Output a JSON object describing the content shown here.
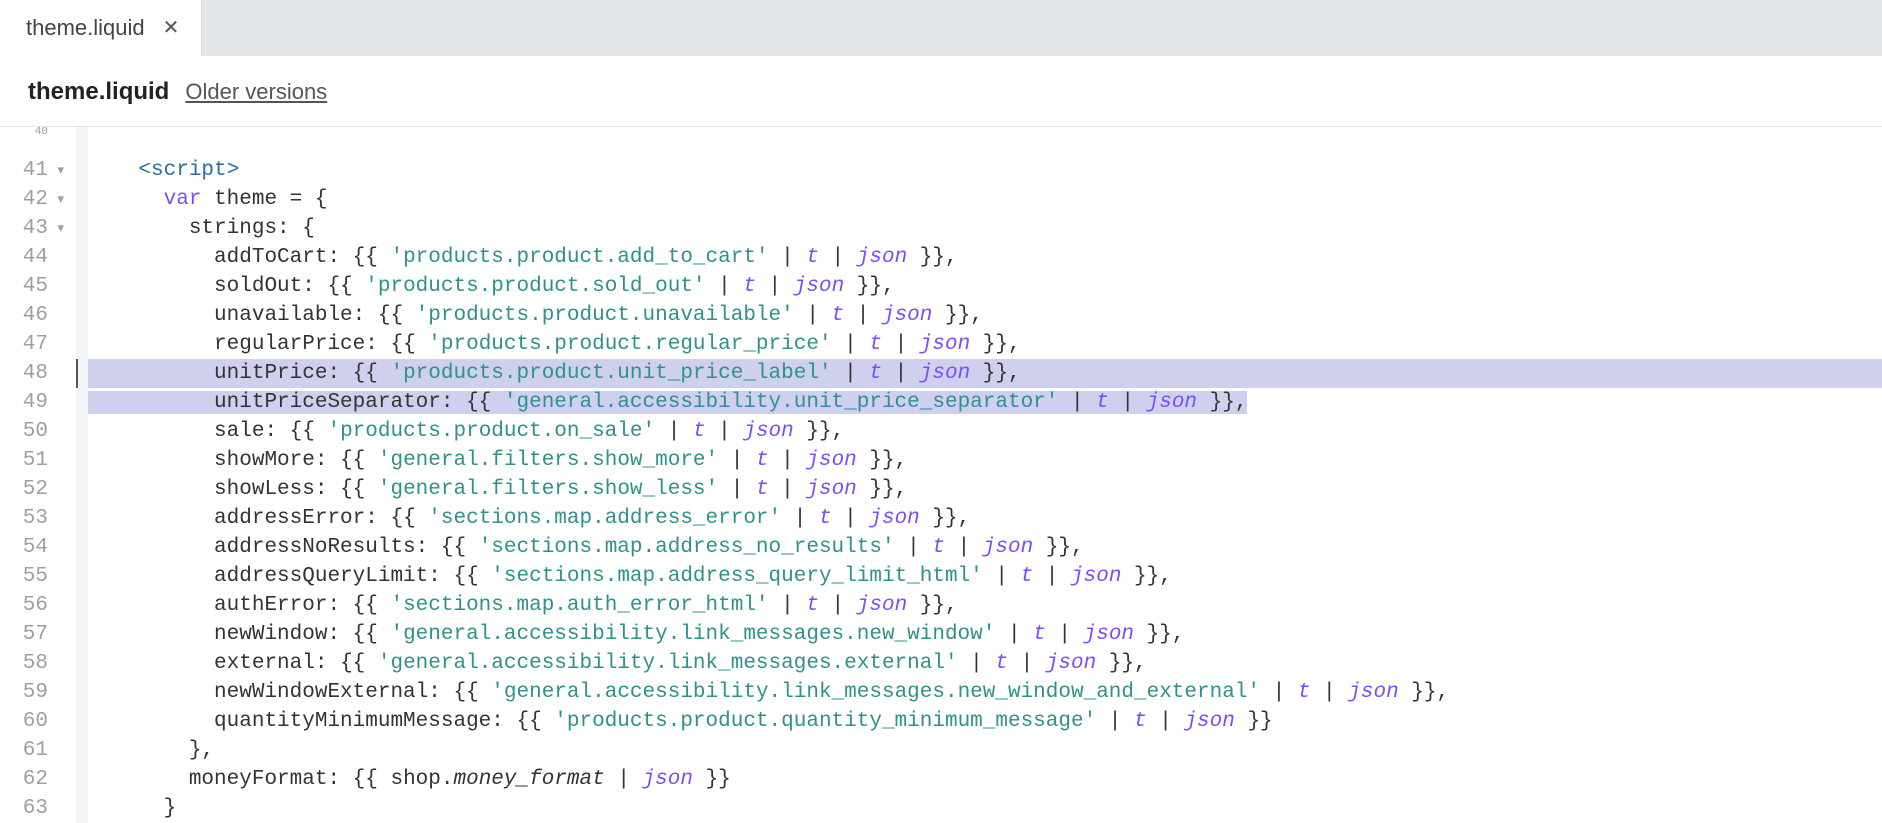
{
  "tab": {
    "label": "theme.liquid"
  },
  "subheader": {
    "title": "theme.liquid",
    "older": "Older versions"
  },
  "lines": [
    {
      "n": 40,
      "kind": "tiny",
      "html": ""
    },
    {
      "n": 41,
      "kind": "fold",
      "html": "    <span class='tok-tag'>&lt;script&gt;</span>"
    },
    {
      "n": 42,
      "kind": "fold",
      "html": "      <span class='tok-kw'>var</span> <span class='tok-var'>theme</span> = {"
    },
    {
      "n": 43,
      "kind": "fold",
      "html": "        <span class='tok-var'>strings</span>: {"
    },
    {
      "n": 44,
      "kind": "",
      "html": "          <span class='tok-key'>addToCart</span>: {{ <span class='tok-str'>'products.product.add_to_cart'</span> | <span class='tok-filter'>t</span> | <span class='tok-filter'>json</span> }},"
    },
    {
      "n": 45,
      "kind": "",
      "html": "          <span class='tok-key'>soldOut</span>: {{ <span class='tok-str'>'products.product.sold_out'</span> | <span class='tok-filter'>t</span> | <span class='tok-filter'>json</span> }},"
    },
    {
      "n": 46,
      "kind": "",
      "html": "          <span class='tok-key'>unavailable</span>: {{ <span class='tok-str'>'products.product.unavailable'</span> | <span class='tok-filter'>t</span> | <span class='tok-filter'>json</span> }},"
    },
    {
      "n": 47,
      "kind": "",
      "html": "          <span class='tok-key'>regularPrice</span>: {{ <span class='tok-str'>'products.product.regular_price'</span> | <span class='tok-filter'>t</span> | <span class='tok-filter'>json</span> }},"
    },
    {
      "n": 48,
      "kind": "hl",
      "html": "          <span class='tok-key'>unitPrice</span>: {{ <span class='tok-str'>'products.product.unit_price_label'</span> | <span class='tok-filter'>t</span> | <span class='tok-filter'>json</span> }},"
    },
    {
      "n": 49,
      "kind": "hl",
      "html": "          <span class='tok-key'>unitPriceSeparator</span>: {{ <span class='tok-str'>'general.accessibility.unit_price_separator'</span> | <span class='tok-filter'>t</span> | <span class='tok-filter'>json</span> }},"
    },
    {
      "n": 50,
      "kind": "",
      "html": "          <span class='tok-key'>sale</span>: {{ <span class='tok-str'>'products.product.on_sale'</span> | <span class='tok-filter'>t</span> | <span class='tok-filter'>json</span> }},"
    },
    {
      "n": 51,
      "kind": "",
      "html": "          <span class='tok-key'>showMore</span>: {{ <span class='tok-str'>'general.filters.show_more'</span> | <span class='tok-filter'>t</span> | <span class='tok-filter'>json</span> }},"
    },
    {
      "n": 52,
      "kind": "",
      "html": "          <span class='tok-key'>showLess</span>: {{ <span class='tok-str'>'general.filters.show_less'</span> | <span class='tok-filter'>t</span> | <span class='tok-filter'>json</span> }},"
    },
    {
      "n": 53,
      "kind": "",
      "html": "          <span class='tok-key'>addressError</span>: {{ <span class='tok-str'>'sections.map.address_error'</span> | <span class='tok-filter'>t</span> | <span class='tok-filter'>json</span> }},"
    },
    {
      "n": 54,
      "kind": "",
      "html": "          <span class='tok-key'>addressNoResults</span>: {{ <span class='tok-str'>'sections.map.address_no_results'</span> | <span class='tok-filter'>t</span> | <span class='tok-filter'>json</span> }},"
    },
    {
      "n": 55,
      "kind": "",
      "html": "          <span class='tok-key'>addressQueryLimit</span>: {{ <span class='tok-str'>'sections.map.address_query_limit_html'</span> | <span class='tok-filter'>t</span> | <span class='tok-filter'>json</span> }},"
    },
    {
      "n": 56,
      "kind": "",
      "html": "          <span class='tok-key'>authError</span>: {{ <span class='tok-str'>'sections.map.auth_error_html'</span> | <span class='tok-filter'>t</span> | <span class='tok-filter'>json</span> }},"
    },
    {
      "n": 57,
      "kind": "",
      "html": "          <span class='tok-key'>newWindow</span>: {{ <span class='tok-str'>'general.accessibility.link_messages.new_window'</span> | <span class='tok-filter'>t</span> | <span class='tok-filter'>json</span> }},"
    },
    {
      "n": 58,
      "kind": "",
      "html": "          <span class='tok-key'>external</span>: {{ <span class='tok-str'>'general.accessibility.link_messages.external'</span> | <span class='tok-filter'>t</span> | <span class='tok-filter'>json</span> }},"
    },
    {
      "n": 59,
      "kind": "",
      "html": "          <span class='tok-key'>newWindowExternal</span>: {{ <span class='tok-str'>'general.accessibility.link_messages.new_window_and_external'</span> | <span class='tok-filter'>t</span> | <span class='tok-filter'>json</span> }},"
    },
    {
      "n": 60,
      "kind": "",
      "html": "          <span class='tok-key'>quantityMinimumMessage</span>: {{ <span class='tok-str'>'products.product.quantity_minimum_message'</span> | <span class='tok-filter'>t</span> | <span class='tok-filter'>json</span> }}"
    },
    {
      "n": 61,
      "kind": "",
      "html": "        },"
    },
    {
      "n": 62,
      "kind": "",
      "html": "        <span class='tok-key'>moneyFormat</span>: {{ <span class='tok-var'>shop</span>.<span class='tok-ident'>money_format</span> | <span class='tok-filter'>json</span> }}"
    },
    {
      "n": 63,
      "kind": "",
      "html": "      }"
    }
  ],
  "highlight_end_partial_cols": 92
}
